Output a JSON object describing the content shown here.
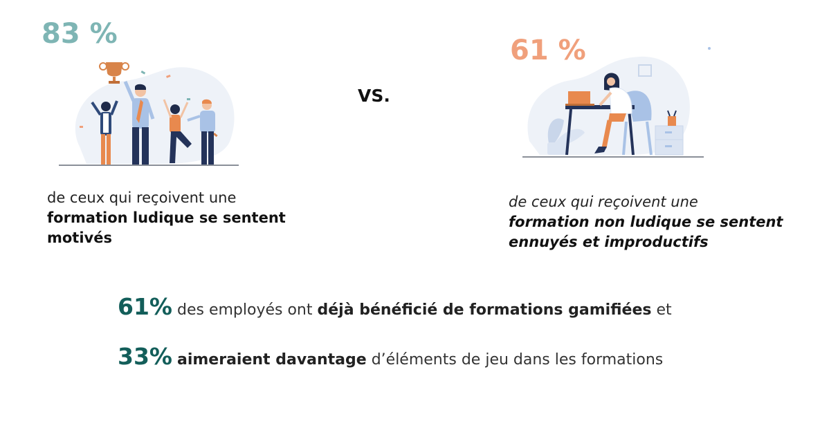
{
  "left": {
    "stat": "83 %",
    "caption_plain": "de ceux qui reçoivent une",
    "caption_bold": "formation ludique se sentent motivés"
  },
  "separator": "VS.",
  "right": {
    "stat": "61 %",
    "caption_plain": "de ceux qui reçoivent une",
    "caption_bold": "formation non ludique se sentent ennuyés et improductifs"
  },
  "facts": [
    {
      "pct": "61%",
      "text_1": "des employés ont",
      "bold": "déjà bénéficié de formations gamifiées",
      "text_2": "et"
    },
    {
      "pct": "33%",
      "bold": "aimeraient davantage",
      "text_1": "d’éléments de jeu dans les formations"
    }
  ],
  "colors": {
    "left_accent": "#7eb5b4",
    "right_accent": "#f0a07c",
    "facts_accent": "#135e5a"
  },
  "icons": {
    "left_illustration": "celebrating-team-trophy-illustration",
    "right_illustration": "bored-worker-at-desk-illustration"
  }
}
